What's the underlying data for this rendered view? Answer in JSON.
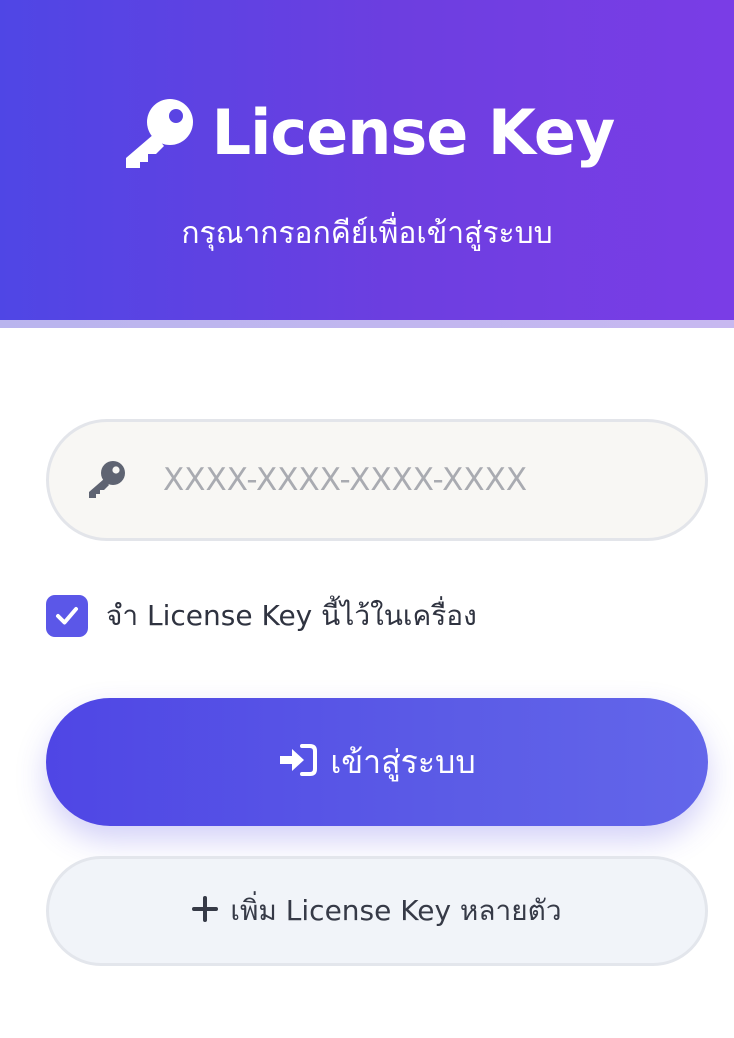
{
  "header": {
    "title": "License Key",
    "subtitle": "กรุณากรอกคีย์เพื่อเข้าสู่ระบบ",
    "icon": "key-icon"
  },
  "form": {
    "license_input": {
      "value": "",
      "placeholder": "XXXX-XXXX-XXXX-XXXX",
      "icon": "key-icon"
    },
    "remember": {
      "checked": true,
      "label": "จำ License Key นี้ไว้ในเครื่อง"
    },
    "login_button": {
      "label": "เข้าสู่ระบบ",
      "icon": "sign-in-icon"
    },
    "add_button": {
      "label": "เพิ่ม License Key หลายตัว",
      "icon": "plus-icon"
    }
  },
  "colors": {
    "accent": "#4f46e5",
    "accent_end": "#7a3de6",
    "checkbox": "#5b57e8",
    "input_bg": "#f8f7f4"
  }
}
